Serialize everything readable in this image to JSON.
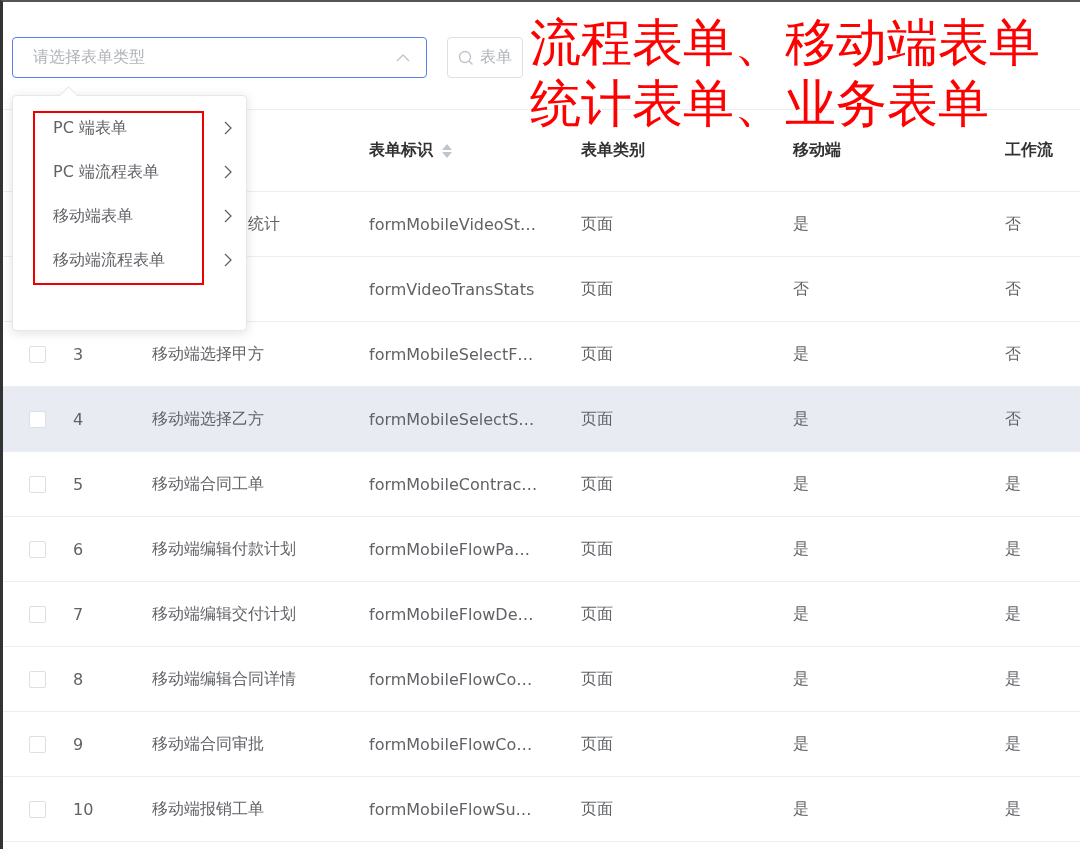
{
  "filters": {
    "type_select": {
      "placeholder": "请选择表单类型",
      "expanded": true
    },
    "search": {
      "placeholder": "表单"
    }
  },
  "dropdown": {
    "items": [
      {
        "label": "PC 端表单"
      },
      {
        "label": "PC 端流程表单"
      },
      {
        "label": "移动端表单"
      },
      {
        "label": "移动端流程表单"
      }
    ]
  },
  "annotation": [
    "流程表单、移动端表单",
    "统计表单、业务表单"
  ],
  "table": {
    "columns": [
      {
        "label": "表单标识",
        "sortable": true
      },
      {
        "label": "表单类别",
        "sortable": false
      },
      {
        "label": "移动端",
        "sortable": false
      },
      {
        "label": "工作流",
        "sortable": false
      }
    ],
    "rows": [
      {
        "name": "统计",
        "id": "formMobileVideoSt…",
        "type": "页面",
        "mobile": "是",
        "workflow": "否",
        "hovered": false
      },
      {
        "id": "formVideoTransStats",
        "type": "页面",
        "mobile": "否",
        "workflow": "否",
        "hovered": false
      },
      {
        "checked": false,
        "index": "3",
        "name": "移动端选择甲方",
        "id": "formMobileSelectF…",
        "type": "页面",
        "mobile": "是",
        "workflow": "否",
        "hovered": false
      },
      {
        "checked": false,
        "index": "4",
        "name": "移动端选择乙方",
        "id": "formMobileSelectS…",
        "type": "页面",
        "mobile": "是",
        "workflow": "否",
        "hovered": true
      },
      {
        "checked": false,
        "index": "5",
        "name": "移动端合同工单",
        "id": "formMobileContrac…",
        "type": "页面",
        "mobile": "是",
        "workflow": "是",
        "hovered": false
      },
      {
        "checked": false,
        "index": "6",
        "name": "移动端编辑付款计划",
        "id": "formMobileFlowPa…",
        "type": "页面",
        "mobile": "是",
        "workflow": "是",
        "hovered": false
      },
      {
        "checked": false,
        "index": "7",
        "name": "移动端编辑交付计划",
        "id": "formMobileFlowDe…",
        "type": "页面",
        "mobile": "是",
        "workflow": "是",
        "hovered": false
      },
      {
        "checked": false,
        "index": "8",
        "name": "移动端编辑合同详情",
        "id": "formMobileFlowCo…",
        "type": "页面",
        "mobile": "是",
        "workflow": "是",
        "hovered": false
      },
      {
        "checked": false,
        "index": "9",
        "name": "移动端合同审批",
        "id": "formMobileFlowCo…",
        "type": "页面",
        "mobile": "是",
        "workflow": "是",
        "hovered": false
      },
      {
        "checked": false,
        "index": "10",
        "name": "移动端报销工单",
        "id": "formMobileFlowSu…",
        "type": "页面",
        "mobile": "是",
        "workflow": "是",
        "hovered": false
      }
    ]
  }
}
